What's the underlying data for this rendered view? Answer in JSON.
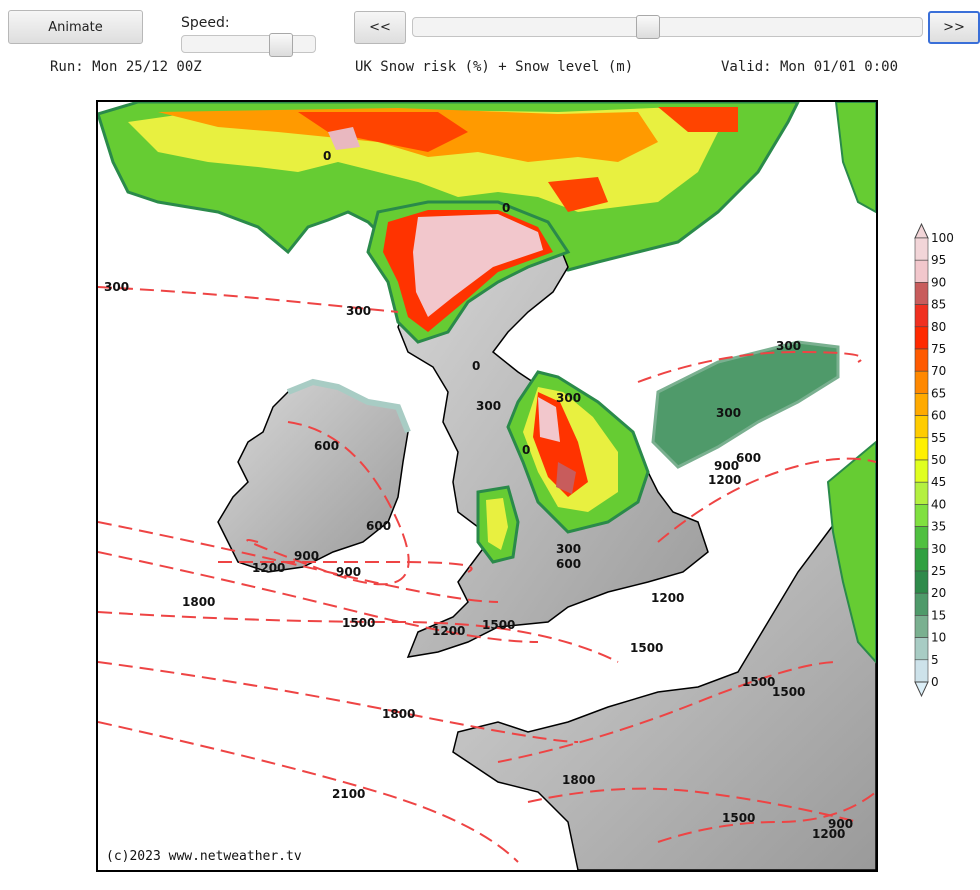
{
  "controls": {
    "animate_label": "Animate",
    "speed_label": "Speed:",
    "speed_value": 0.8,
    "prev_label": "<<",
    "next_label": ">>",
    "timeline_value": 0.46
  },
  "header": {
    "run": "Run: Mon 25/12 00Z",
    "title": "UK Snow risk (%) + Snow level (m)",
    "valid": "Valid: Mon 01/01 0:00"
  },
  "map": {
    "copyright": "(c)2023 www.netweather.tv",
    "contour_labels": [
      "300",
      "300",
      "0",
      "0",
      "0",
      "300",
      "300",
      "0",
      "600",
      "300",
      "600",
      "300",
      "900",
      "1200",
      "600",
      "900",
      "1200",
      "900",
      "300",
      "600",
      "1800",
      "1500",
      "1200",
      "1500",
      "1200",
      "1500",
      "1500",
      "1500",
      "1800",
      "2100",
      "1800",
      "1500",
      "1200",
      "900"
    ]
  },
  "legend": {
    "levels": [
      "100",
      "95",
      "90",
      "85",
      "80",
      "75",
      "70",
      "65",
      "60",
      "55",
      "50",
      "45",
      "40",
      "35",
      "30",
      "25",
      "20",
      "15",
      "10",
      "5",
      "0"
    ],
    "colors": [
      "#f2d5d8",
      "#f2c7cc",
      "#c85c5c",
      "#f03020",
      "#ff2a00",
      "#ff5a00",
      "#ff8800",
      "#ffaa00",
      "#ffcc00",
      "#fff000",
      "#e0ff20",
      "#b4f040",
      "#80e040",
      "#50c040",
      "#30a040",
      "#2e8a4a",
      "#4f9a6a",
      "#7ab090",
      "#a8ccc4",
      "#cde2ea",
      "#dceff8"
    ]
  }
}
